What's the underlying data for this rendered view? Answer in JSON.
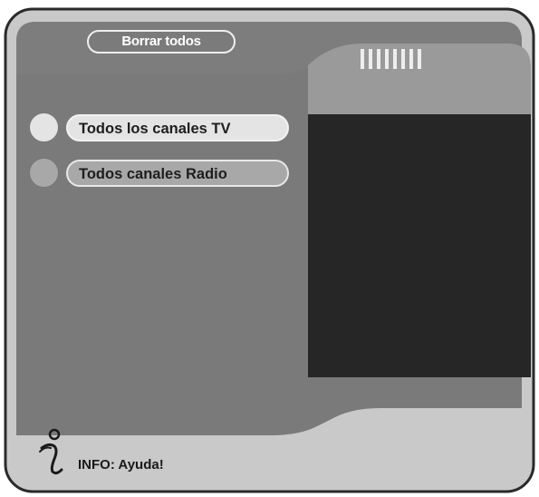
{
  "header": {
    "title": "Borrar todos",
    "signal_bars": 8
  },
  "options": [
    {
      "label": "Todos los canales TV",
      "selected": true
    },
    {
      "label": "Todos canales Radio",
      "selected": false
    }
  ],
  "footer": {
    "info_icon": "info-icon",
    "info_text": "INFO: Ayuda!"
  },
  "colors": {
    "panel": "#7a7a7a",
    "panel_light": "#959595",
    "frame": "#c9c9c9",
    "preview": "#262626",
    "option_selected": "#e4e4e4",
    "option_unselected": "#a8a8a8"
  }
}
